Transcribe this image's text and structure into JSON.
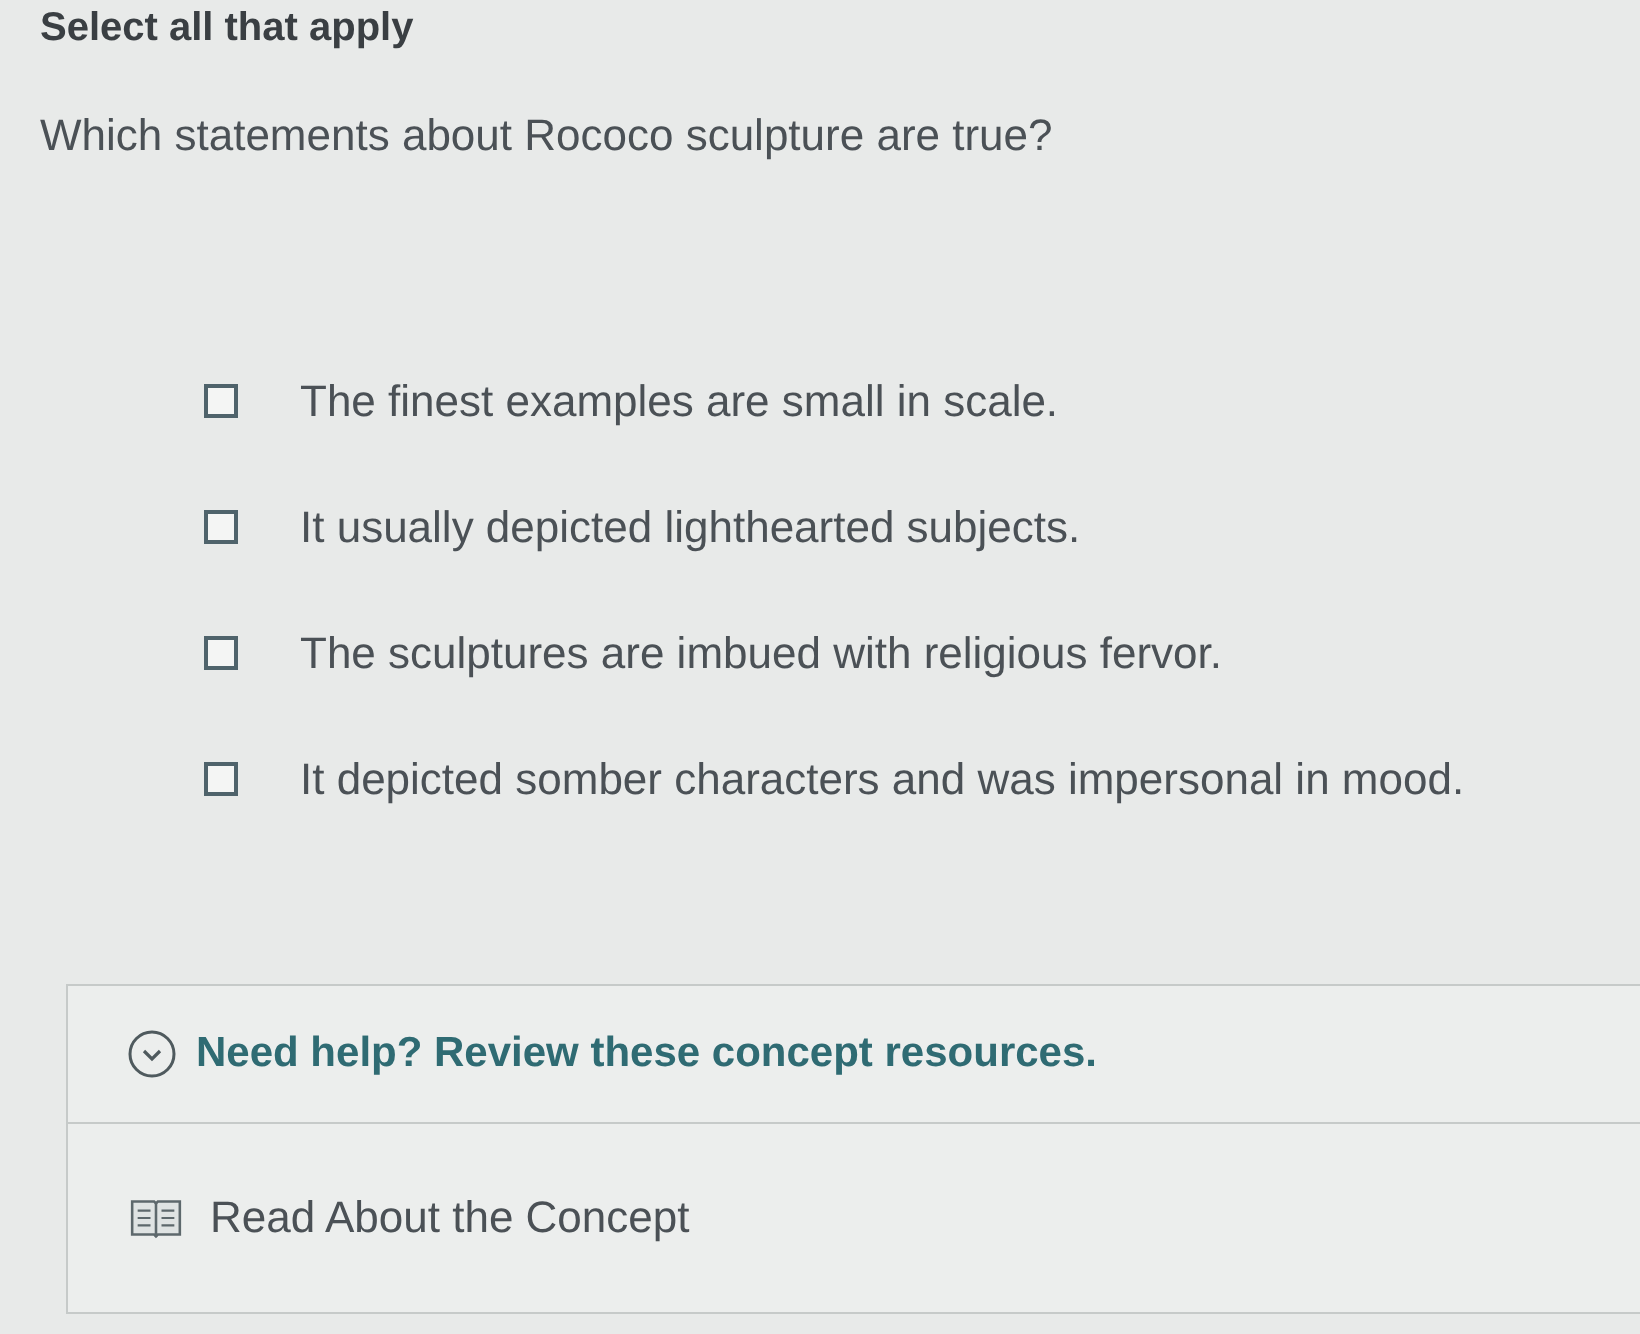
{
  "instruction": "Select all that apply",
  "question": "Which statements about Rococo sculpture are true?",
  "options": [
    {
      "label": "The finest examples are small in scale.",
      "checked": false
    },
    {
      "label": "It usually depicted lighthearted subjects.",
      "checked": false
    },
    {
      "label": "The sculptures are imbued with religious fervor.",
      "checked": false
    },
    {
      "label": "It depicted somber characters and was impersonal in mood.",
      "checked": false
    }
  ],
  "help": {
    "title": "Need help? Review these concept resources.",
    "resources": [
      {
        "label": "Read About the Concept"
      }
    ]
  }
}
